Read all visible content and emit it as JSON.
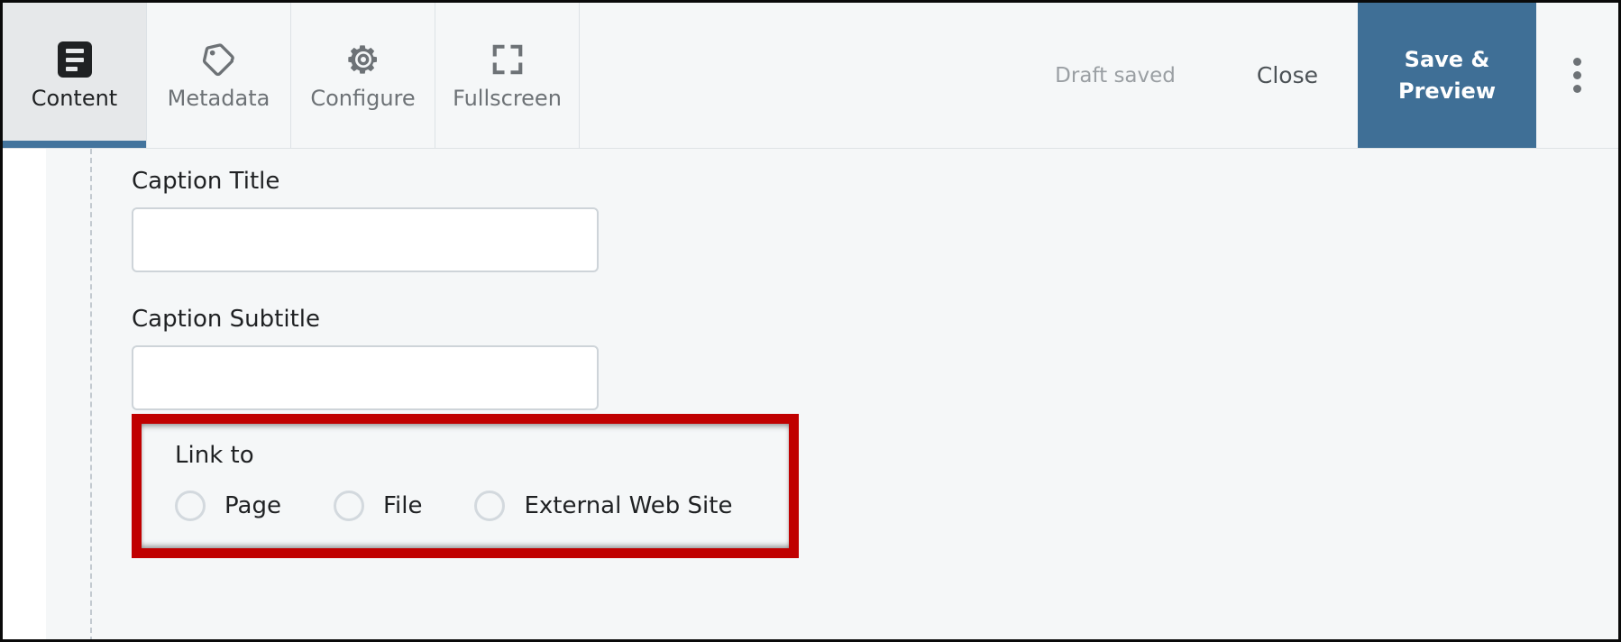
{
  "toolbar": {
    "tabs": [
      {
        "label": "Content",
        "icon": "document-lines-icon",
        "active": true
      },
      {
        "label": "Metadata",
        "icon": "tag-icon",
        "active": false
      },
      {
        "label": "Configure",
        "icon": "gear-icon",
        "active": false
      },
      {
        "label": "Fullscreen",
        "icon": "expand-icon",
        "active": false
      }
    ],
    "status": "Draft saved",
    "close_label": "Close",
    "save_label": "Save & Preview",
    "overflow_icon": "kebab-menu-icon",
    "accent_color": "#3f6f96",
    "active_tab_bg": "#e6e8ea",
    "toolbar_bg": "#f5f7f8"
  },
  "form": {
    "fields": [
      {
        "label": "Caption Title",
        "value": "",
        "placeholder": ""
      },
      {
        "label": "Caption Subtitle",
        "value": "",
        "placeholder": ""
      }
    ],
    "link_to": {
      "label": "Link to",
      "options": [
        {
          "label": "Page",
          "selected": false
        },
        {
          "label": "File",
          "selected": false
        },
        {
          "label": "External Web Site",
          "selected": false
        }
      ],
      "highlight_color": "#c00000"
    }
  }
}
